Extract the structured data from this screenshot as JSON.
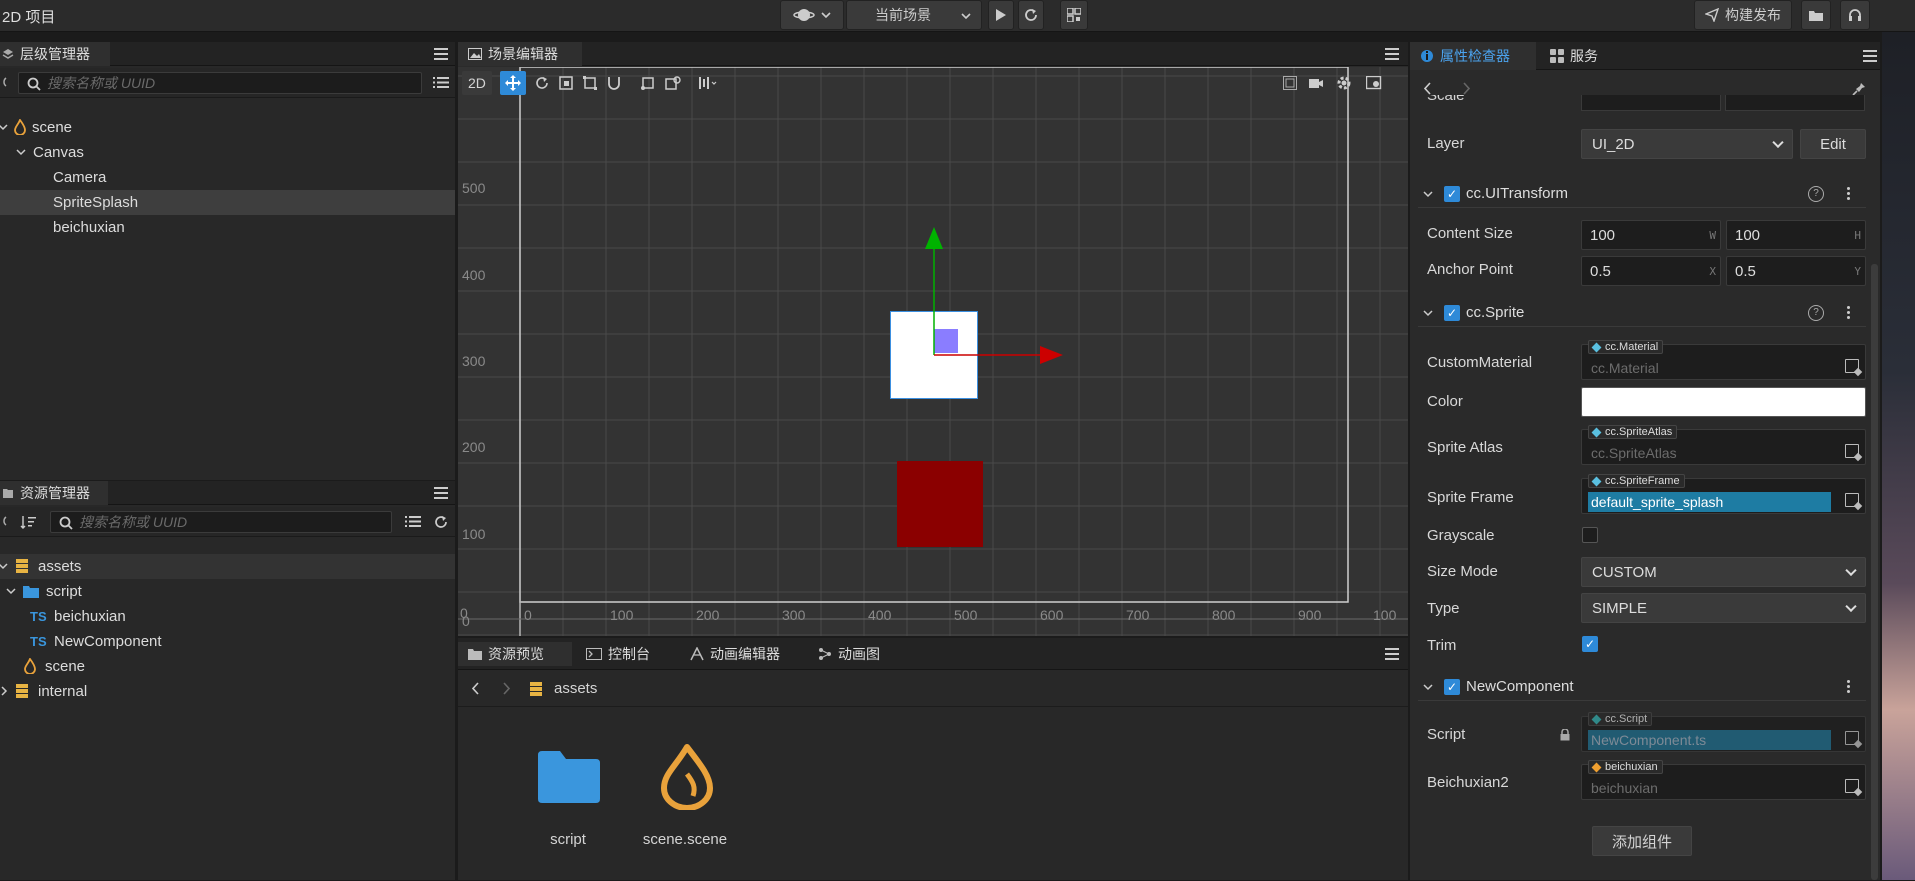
{
  "app": {
    "title": "2D 项目"
  },
  "toolbar": {
    "scene_select": "当前场景",
    "publish_label": "构建发布"
  },
  "hierarchy": {
    "tab": "层级管理器",
    "search_placeholder": "搜索名称或 UUID",
    "items": [
      {
        "label": "scene"
      },
      {
        "label": "Canvas"
      },
      {
        "label": "Camera"
      },
      {
        "label": "SpriteSplash"
      },
      {
        "label": "beichuxian"
      }
    ]
  },
  "assets_panel": {
    "tab": "资源管理器",
    "search_placeholder": "搜索名称或 UUID",
    "items": [
      {
        "label": "assets"
      },
      {
        "label": "script"
      },
      {
        "label": "beichuxian",
        "badge": "TS"
      },
      {
        "label": "NewComponent",
        "badge": "TS"
      },
      {
        "label": "scene"
      },
      {
        "label": "internal"
      }
    ]
  },
  "scene_editor": {
    "tab": "场景编辑器",
    "mode_2d": "2D",
    "y_labels": [
      "500",
      "400",
      "300",
      "200",
      "100",
      "0"
    ],
    "x_labels": [
      "0",
      "0",
      "100",
      "200",
      "300",
      "400",
      "500",
      "600",
      "700",
      "800",
      "900",
      "100"
    ]
  },
  "bottom": {
    "tabs": [
      "资源预览",
      "控制台",
      "动画编辑器",
      "动画图"
    ],
    "path": "assets",
    "files": [
      {
        "label": "script"
      },
      {
        "label": "scene.scene"
      }
    ]
  },
  "inspector": {
    "tabs": [
      "属性检查器",
      "服务"
    ],
    "scale_label": "Scale",
    "layer": {
      "label": "Layer",
      "value": "UI_2D",
      "edit": "Edit"
    },
    "uitransform": {
      "title": "cc.UITransform",
      "content_size_label": "Content Size",
      "w": "100",
      "h": "100",
      "w_suffix": "W",
      "h_suffix": "H",
      "anchor_label": "Anchor Point",
      "ax": "0.5",
      "ay": "0.5",
      "x_suffix": "X",
      "y_suffix": "Y"
    },
    "sprite": {
      "title": "cc.Sprite",
      "custom_material_label": "CustomMaterial",
      "custom_material_tag": "cc.Material",
      "custom_material_value": "cc.Material",
      "color_label": "Color",
      "atlas_label": "Sprite Atlas",
      "atlas_tag": "cc.SpriteAtlas",
      "atlas_value": "cc.SpriteAtlas",
      "frame_label": "Sprite Frame",
      "frame_tag": "cc.SpriteFrame",
      "frame_value": "default_sprite_splash",
      "grayscale_label": "Grayscale",
      "size_mode_label": "Size Mode",
      "size_mode_value": "CUSTOM",
      "type_label": "Type",
      "type_value": "SIMPLE",
      "trim_label": "Trim"
    },
    "newcomponent": {
      "title": "NewComponent",
      "script_label": "Script",
      "script_tag": "cc.Script",
      "script_value": "NewComponent.ts",
      "beichuxian_label": "Beichuxian2",
      "beichuxian_tag": "beichuxian",
      "beichuxian_value": "beichuxian"
    },
    "add_component": "添加组件"
  },
  "colors": {
    "accent": "#2e8ad8",
    "selected_field": "#1e7ca3",
    "red_square": "#8b0000",
    "gizmo_x": "#cc0000",
    "gizmo_y": "#00b300"
  }
}
